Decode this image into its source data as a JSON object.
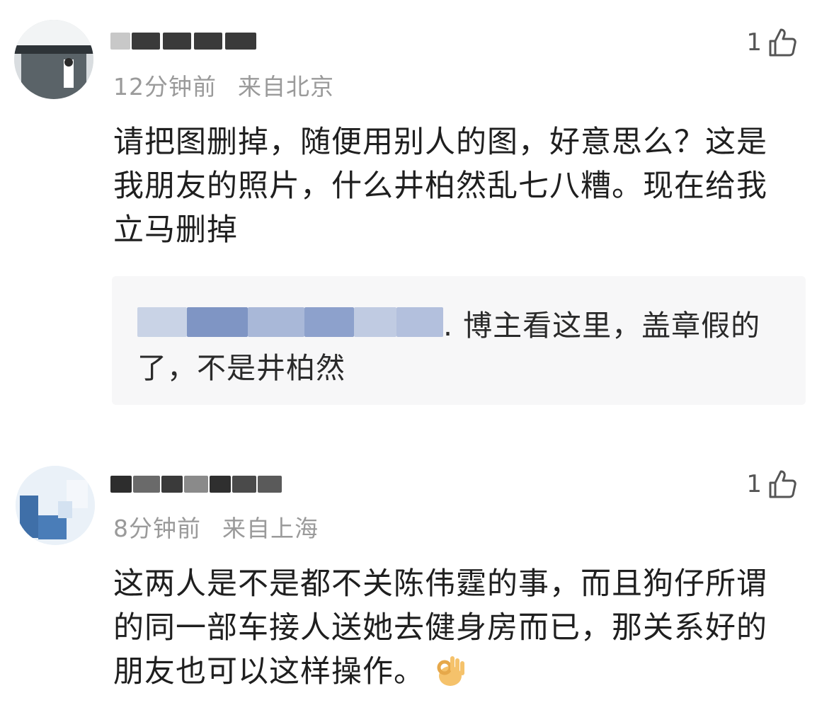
{
  "comments": [
    {
      "avatar_icon": "user-avatar-photo",
      "time": "12分钟前",
      "location": "来自北京",
      "like_count": "1",
      "like_icon": "thumb-up-icon",
      "text": "请把图删掉，随便用别人的图，好意思么？这是我朋友的照片，什么井柏然乱七八糟。现在给我立马删掉",
      "quote": {
        "text": ". 博主看这里，盖章假的了，不是井柏然"
      }
    },
    {
      "avatar_icon": "user-avatar-photo",
      "time": "8分钟前",
      "location": "来自上海",
      "like_count": "1",
      "like_icon": "thumb-up-icon",
      "text": "这两人是不是都不关陈伟霆的事，而且狗仔所谓的同一部车接人送她去健身房而已，那关系好的朋友也可以这样操作。",
      "emoji": "ok-hand-emoji"
    }
  ],
  "colors": {
    "meta_text": "#9a9a9a",
    "body_text": "#1f1f1f",
    "quote_bg": "#f7f7f8"
  }
}
